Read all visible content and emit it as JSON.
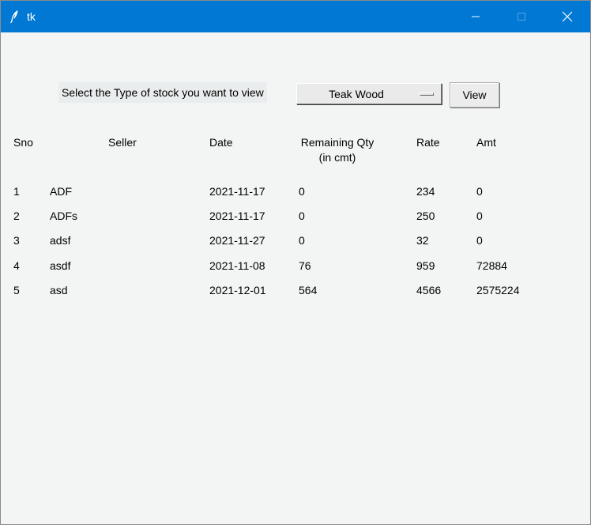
{
  "window": {
    "title": "tk",
    "accent_color": "#0078d4",
    "controls": [
      "minimize-icon",
      "maximize-icon",
      "close-icon"
    ]
  },
  "filter": {
    "prompt": "Select the Type of stock you want to view",
    "selected_type": "Teak Wood",
    "view_label": "View"
  },
  "table": {
    "headers": {
      "sno": "Sno",
      "seller": "Seller",
      "date": "Date",
      "qty_line1": "Remaining Qty",
      "qty_line2": "(in cmt)",
      "rate": "Rate",
      "amt": "Amt"
    },
    "rows": [
      {
        "sno": "1",
        "seller": "ADF",
        "date": "2021-11-17",
        "qty": "0",
        "rate": "234",
        "amt": "0"
      },
      {
        "sno": "2",
        "seller": "ADFs",
        "date": "2021-11-17",
        "qty": "0",
        "rate": "250",
        "amt": "0"
      },
      {
        "sno": "3",
        "seller": "adsf",
        "date": "2021-11-27",
        "qty": "0",
        "rate": "32",
        "amt": "0"
      },
      {
        "sno": "4",
        "seller": "asdf",
        "date": "2021-11-08",
        "qty": "76",
        "rate": "959",
        "amt": "72884"
      },
      {
        "sno": "5",
        "seller": "asd",
        "date": "2021-12-01",
        "qty": "564",
        "rate": "4566",
        "amt": "2575224"
      }
    ]
  }
}
